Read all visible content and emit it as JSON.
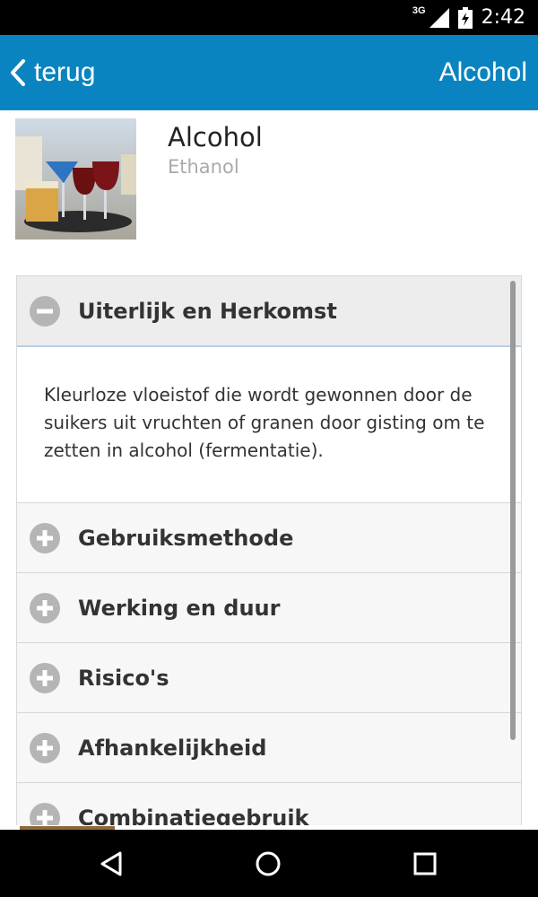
{
  "status_bar": {
    "network_type": "3G",
    "time": "2:42",
    "icons": [
      "signal-icon",
      "battery-charging-icon"
    ]
  },
  "app_bar": {
    "back_label": "terug",
    "title": "Alcohol",
    "color": "#0a84c0"
  },
  "item": {
    "title": "Alcohol",
    "subtitle": "Ethanol",
    "image": "alcoholic-drinks-photo"
  },
  "accordion": {
    "sections": [
      {
        "label": "Uiterlijk en Herkomst",
        "expanded": true,
        "icon": "minus-circle-icon",
        "body": "Kleurloze vloeistof die wordt gewonnen door de suikers uit vruchten of granen door gisting om te zetten in alcohol (fermentatie)."
      },
      {
        "label": "Gebruiksmethode",
        "expanded": false,
        "icon": "plus-circle-icon"
      },
      {
        "label": "Werking en duur",
        "expanded": false,
        "icon": "plus-circle-icon"
      },
      {
        "label": "Risico's",
        "expanded": false,
        "icon": "plus-circle-icon"
      },
      {
        "label": "Afhankelijkheid",
        "expanded": false,
        "icon": "plus-circle-icon"
      },
      {
        "label": "Combinatiegebruik",
        "expanded": false,
        "icon": "plus-circle-icon"
      }
    ]
  },
  "nav_bar": {
    "buttons": [
      "back-triangle-icon",
      "home-circle-icon",
      "recents-square-icon"
    ]
  }
}
